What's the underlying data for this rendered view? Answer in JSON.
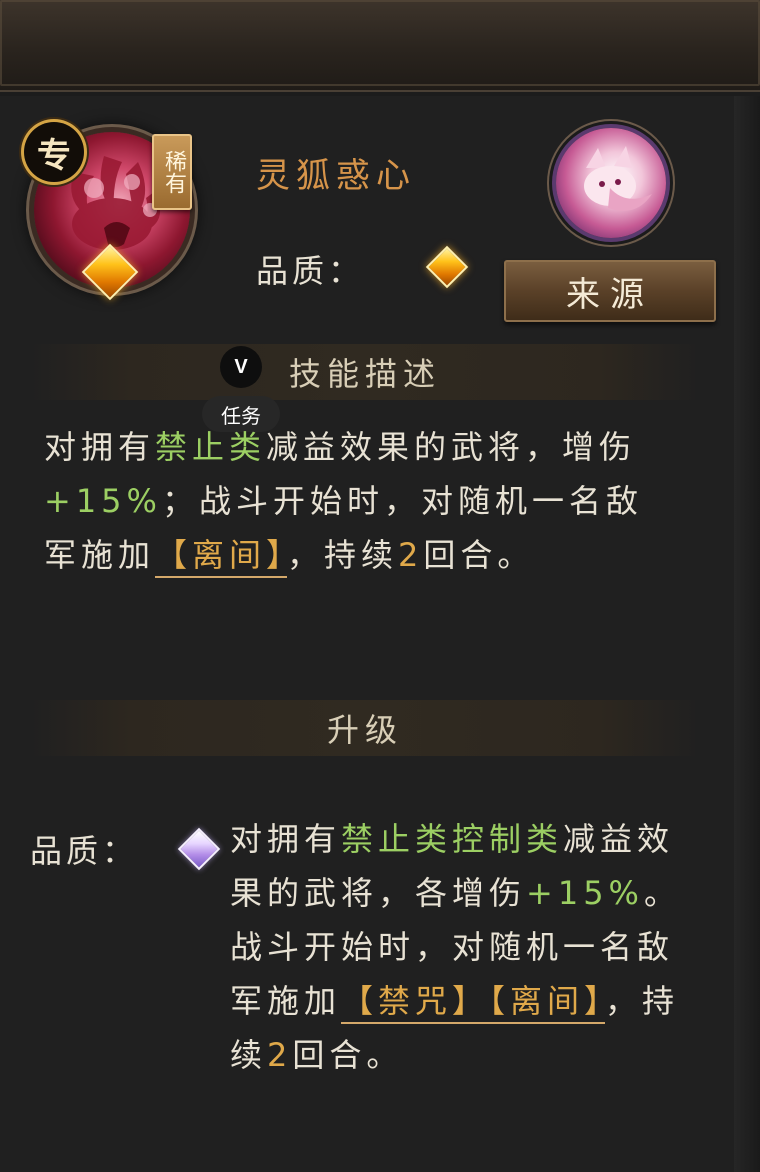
{
  "header": {
    "exclusive_badge": "专",
    "rarity_tag": "稀有",
    "skill_name": "灵狐惑心",
    "quality_label": "品质：",
    "quality_gem_color": "#ffc21a",
    "source_button": "来源"
  },
  "task_overlay": {
    "badge": "V",
    "label": "任务"
  },
  "skill_description": {
    "title": "技能描述",
    "parts": {
      "p1": "对拥有",
      "p2": "禁止类",
      "p3": "减益效果的武将，增伤",
      "p4": "+15%",
      "p5": "；战斗开始时，对随机一名敌军施加",
      "p6": "【离间】",
      "p7": "，持续",
      "p8": "2",
      "p9": "回合。"
    }
  },
  "upgrade": {
    "title": "升级",
    "quality_label": "品质：",
    "quality_gem_color": "#b48ee8",
    "parts": {
      "p1": "对拥有",
      "p2": "禁止类控制类",
      "p3": "减益效果的武将，各增伤",
      "p4": "+15%",
      "p5": "。战斗开始时，对随机一名敌军施加",
      "p6": "【禁咒】",
      "p7": "【离间】",
      "p8": "，持续",
      "p9": "2",
      "p10": "回合。"
    }
  },
  "colors": {
    "keyword_green": "#9ccf63",
    "number_gold": "#e0a94a",
    "skill_name_orange": "#d6944a"
  }
}
